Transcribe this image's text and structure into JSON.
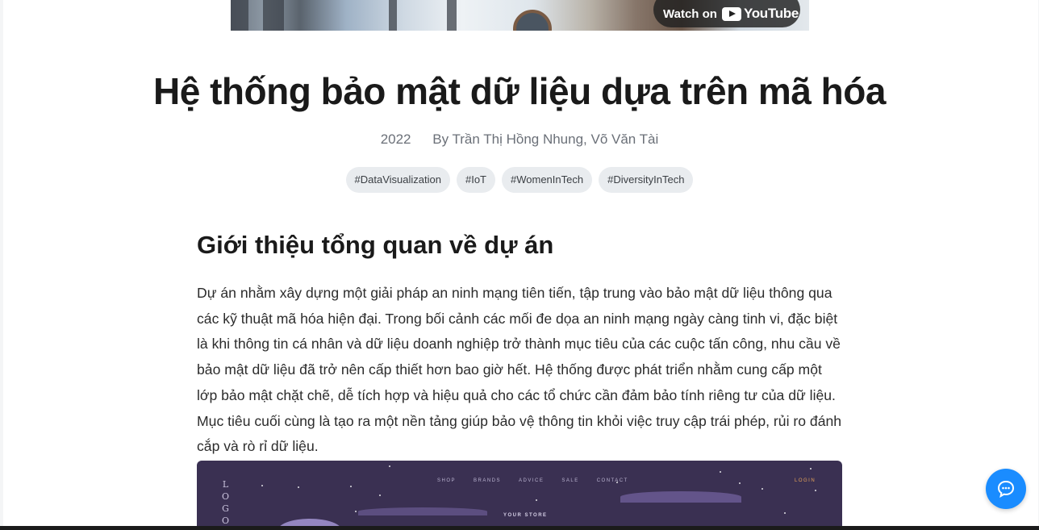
{
  "video": {
    "watch_label": "Watch on",
    "platform": "YouTube"
  },
  "article": {
    "title": "Hệ thống bảo mật dữ liệu dựa trên mã hóa",
    "year": "2022",
    "authors": "By Trần Thị Hồng Nhung, Võ Văn Tài",
    "tags": [
      "#DataVisualization",
      "#IoT",
      "#WomenInTech",
      "#DiversityInTech"
    ],
    "section_title": "Giới thiệu tổng quan về dự án",
    "paragraph": "Dự án nhằm xây dựng một giải pháp an ninh mạng tiên tiến, tập trung vào bảo mật dữ liệu thông qua các kỹ thuật mã hóa hiện đại. Trong bối cảnh các mối đe dọa an ninh mạng ngày càng tinh vi, đặc biệt là khi thông tin cá nhân và dữ liệu doanh nghiệp trở thành mục tiêu của các cuộc tấn công, nhu cầu về bảo mật dữ liệu đã trở nên cấp thiết hơn bao giờ hết. Hệ thống được phát triển nhằm cung cấp một lớp bảo mật chặt chẽ, dễ tích hợp và hiệu quả cho các tổ chức cần đảm bảo tính riêng tư của dữ liệu. Mục tiêu cuối cùng là tạo ra một nền tảng giúp bảo vệ thông tin khỏi việc truy cập trái phép, rủi ro đánh cắp và rò rỉ dữ liệu."
  },
  "preview_image": {
    "logo_letters": [
      "L",
      "O",
      "G",
      "O"
    ],
    "nav": [
      "SHOP",
      "BRANDS",
      "ADVICE",
      "SALE",
      "CONTACT"
    ],
    "login": "LOGIN",
    "store_label": "YOUR STORE"
  },
  "chat_button": {
    "icon": "chat-bubble-icon",
    "color": "#1a8cff"
  }
}
